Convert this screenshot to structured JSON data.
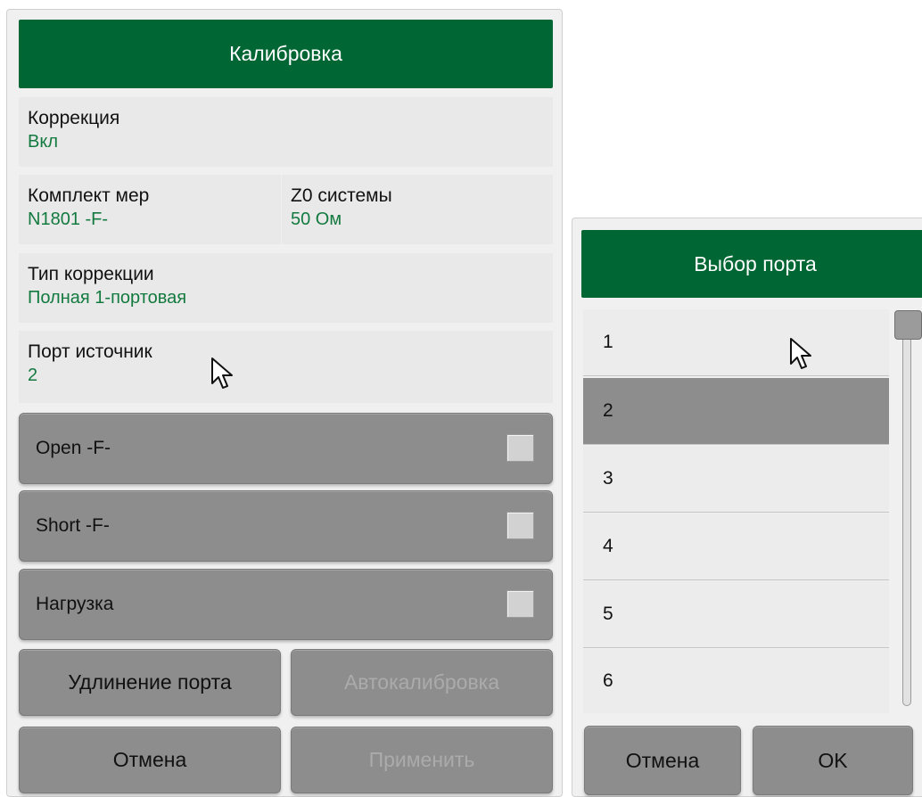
{
  "calibration": {
    "title": "Калибровка",
    "correction": {
      "label": "Коррекция",
      "value": "Вкл"
    },
    "cal_kit": {
      "label": "Комплект мер",
      "value": "N1801 -F-"
    },
    "z0": {
      "label": "Z0 системы",
      "value": "50 Ом"
    },
    "correction_type": {
      "label": "Тип коррекции",
      "value": "Полная 1-портовая"
    },
    "source_port": {
      "label": "Порт источник",
      "value": "2"
    },
    "measurements": [
      {
        "label": "Open -F-"
      },
      {
        "label": "Short -F-"
      },
      {
        "label": "Нагрузка"
      }
    ],
    "port_extension_label": "Удлинение порта",
    "autocal_label": "Автокалибровка",
    "cancel_label": "Отмена",
    "apply_label": "Применить"
  },
  "port_select": {
    "title": "Выбор порта",
    "items": [
      "1",
      "2",
      "3",
      "4",
      "5",
      "6"
    ],
    "selected": "2",
    "cancel_label": "Отмена",
    "ok_label": "OK"
  },
  "colors": {
    "header": "#006633",
    "value_text": "#137a3f",
    "button": "#8d8d8d",
    "disabled_text": "#ababab"
  },
  "icons": {
    "cursor": "mouse-pointer-icon",
    "checkbox": "checkbox-icon"
  }
}
